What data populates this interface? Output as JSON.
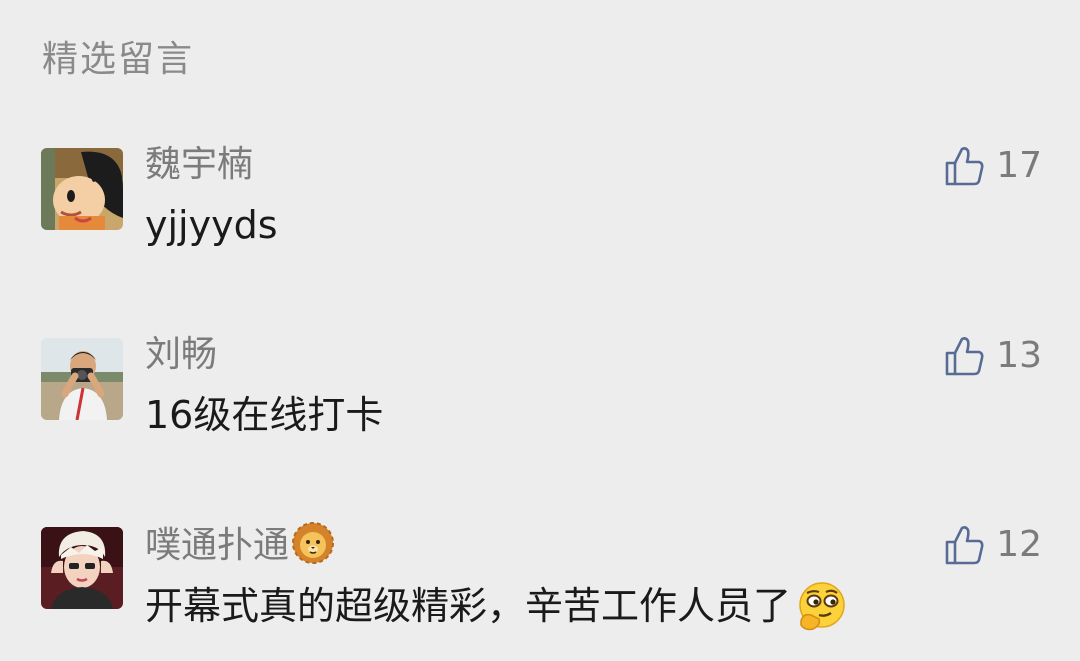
{
  "section": {
    "title": "精选留言"
  },
  "comments": [
    {
      "nickname": "魏宇楠",
      "content": "yjjyyds",
      "likes": "17",
      "avatar": "cartoon-boy-avatar"
    },
    {
      "nickname": "刘畅",
      "content": "16级在线打卡",
      "likes": "13",
      "avatar": "photographer-avatar"
    },
    {
      "nickname": "噗通扑通",
      "nickname_emoji": "lion-emoji",
      "content": "开幕式真的超级精彩，辛苦工作人员了",
      "content_emoji": "thinking-smirk-emoji",
      "likes": "12",
      "avatar": "anime-character-avatar"
    }
  ],
  "colors": {
    "background": "#ededed",
    "secondary_text": "#7b7b7b",
    "primary_text": "#1a1a1a",
    "like_icon": "#576b95"
  }
}
